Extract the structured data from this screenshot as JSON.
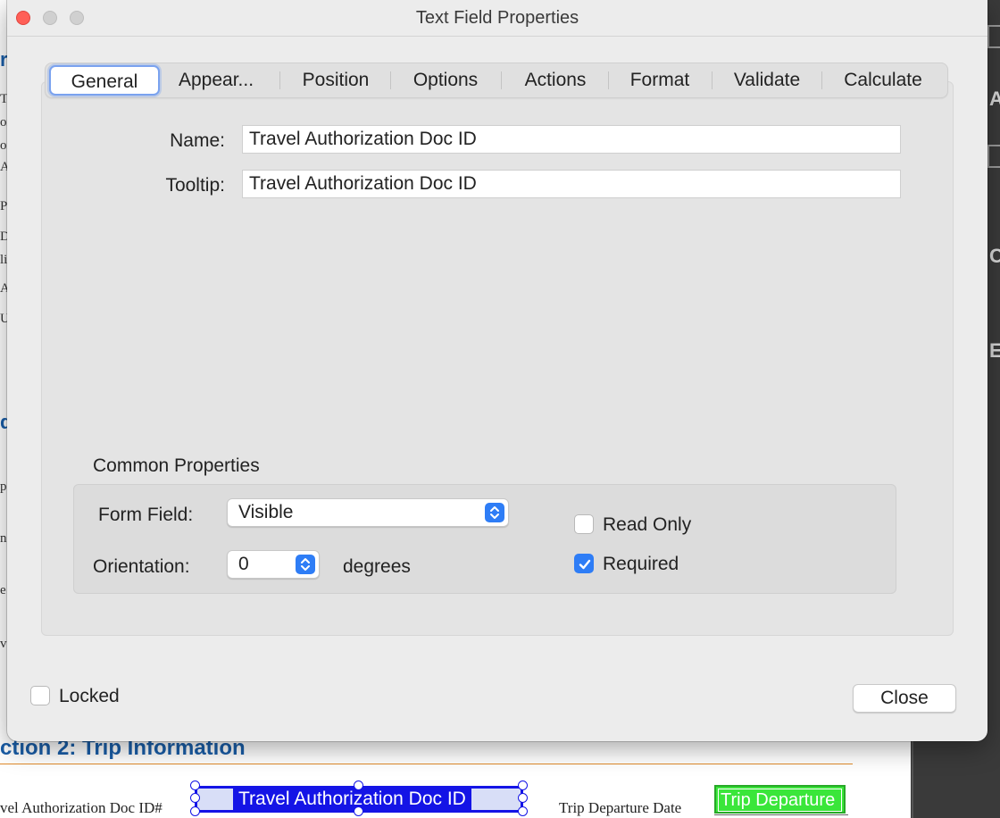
{
  "background": {
    "side_fragments": [
      "re",
      "T",
      "or",
      "or",
      "A",
      "Pr",
      "D",
      "li",
      "A",
      "U",
      "d",
      "pa",
      "n",
      "e",
      "ve"
    ],
    "right_panel_glyphs": [
      "A",
      "C",
      "E"
    ],
    "section_heading": "ction 2:  Trip Information",
    "doc_label_left": "vel Authorization Doc ID#",
    "doc_field_value": "Travel Authorization Doc ID",
    "doc_label_right": "Trip Departure Date",
    "doc_field_right_value": "Trip Departure"
  },
  "dialog": {
    "title": "Text Field Properties",
    "tabs": [
      {
        "label": "General",
        "active": true
      },
      {
        "label": "Appear...",
        "active": false
      },
      {
        "label": "Position",
        "active": false
      },
      {
        "label": "Options",
        "active": false
      },
      {
        "label": "Actions",
        "active": false
      },
      {
        "label": "Format",
        "active": false
      },
      {
        "label": "Validate",
        "active": false
      },
      {
        "label": "Calculate",
        "active": false
      }
    ],
    "name_label": "Name:",
    "name_value": "Travel Authorization Doc ID",
    "tooltip_label": "Tooltip:",
    "tooltip_value": "Travel Authorization Doc ID",
    "common_properties": {
      "title": "Common Properties",
      "form_field_label": "Form Field:",
      "form_field_value": "Visible",
      "orientation_label": "Orientation:",
      "orientation_value": "0",
      "orientation_unit": "degrees",
      "read_only_label": "Read Only",
      "read_only_checked": false,
      "required_label": "Required",
      "required_checked": true
    },
    "locked_label": "Locked",
    "locked_checked": false,
    "close_label": "Close"
  },
  "colors": {
    "accent": "#2e7df6",
    "close_traffic": "#ff5f57",
    "selection_blue": "#1414e6",
    "field_green": "#3ae63a",
    "doc_heading_blue": "#1a5ea8",
    "doc_rule_orange": "#e08a2a"
  }
}
